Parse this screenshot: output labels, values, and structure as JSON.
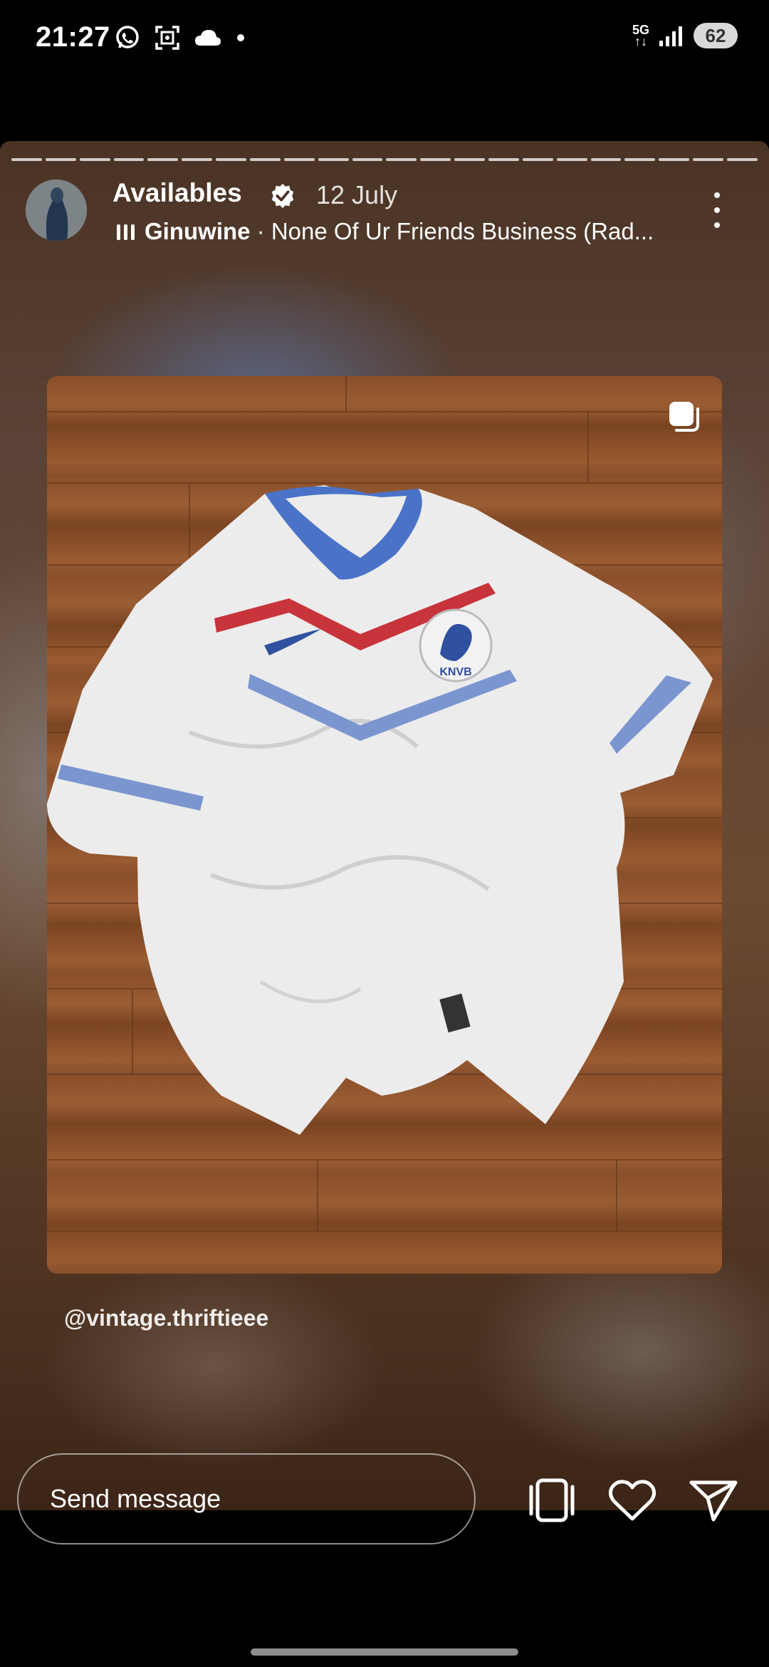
{
  "status_bar": {
    "time": "21:27",
    "left_icons": [
      "whatsapp-icon",
      "screenshot-icon",
      "cloud-icon",
      "dot-icon"
    ],
    "network_label_top": "5G",
    "network_label_bottom": "↑↓",
    "battery_level": "62"
  },
  "story": {
    "progress_segments": 22,
    "username": "Availables",
    "verified": true,
    "date": "12 July",
    "music": {
      "artist": "Ginuwine",
      "separator": " · ",
      "song": "None Of Ur Friends Business (Rad..."
    },
    "mention": "@vintage.thriftieee",
    "photo_label": "KNVB"
  },
  "reply_bar": {
    "placeholder": "Send message",
    "icons": [
      "reshare-icon",
      "heart-icon",
      "send-icon"
    ]
  },
  "colors": {
    "background": "#000000",
    "text": "#ffffff",
    "jersey_blue": "#4a73c8",
    "jersey_red": "#c8343c"
  }
}
